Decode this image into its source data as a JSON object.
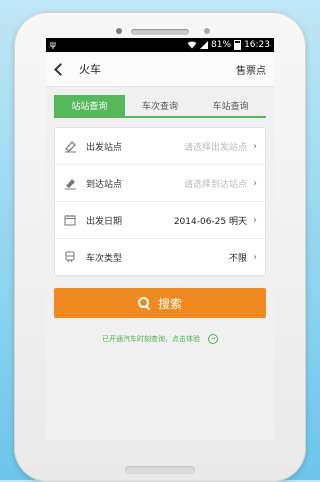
{
  "status_bar": {
    "battery_text": "81%",
    "time": "16:23"
  },
  "header": {
    "title": "火车",
    "ticket_outlet": "售票点"
  },
  "tabs": [
    {
      "label": "站站查询",
      "active": true
    },
    {
      "label": "车次查询",
      "active": false
    },
    {
      "label": "车站查询",
      "active": false
    }
  ],
  "form": {
    "departure": {
      "label": "出发站点",
      "placeholder": "请选择出发站点"
    },
    "arrival": {
      "label": "到达站点",
      "placeholder": "请选择到达站点"
    },
    "date": {
      "label": "出发日期",
      "value": "2014-06-25 明天"
    },
    "train_type": {
      "label": "车次类型",
      "value": "不限"
    }
  },
  "search_button": {
    "label": "搜索"
  },
  "bus_tip": "已开通汽车时刻查询，点击体验",
  "colors": {
    "green": "#56b85b",
    "orange": "#ef8a21"
  }
}
